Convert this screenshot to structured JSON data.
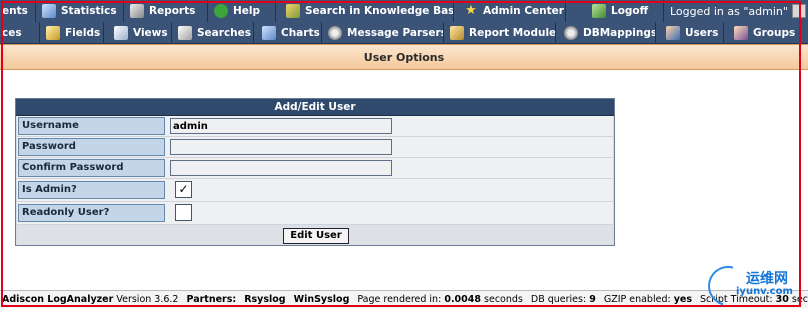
{
  "topnav": {
    "items": [
      {
        "label": "ents",
        "icon": "events-icon"
      },
      {
        "label": "Statistics",
        "icon": "statistics-icon"
      },
      {
        "label": "Reports",
        "icon": "reports-icon"
      },
      {
        "label": "Help",
        "icon": "help-icon"
      },
      {
        "label": "Search in Knowledge Base",
        "icon": "knowledge-base-icon"
      },
      {
        "label": "Admin Center",
        "icon": "star-icon"
      },
      {
        "label": "Logoff",
        "icon": "logoff-icon"
      }
    ],
    "login_text": "Logged in as \"admin\""
  },
  "subnav": {
    "items": [
      {
        "label": "ces",
        "icon": "sources-icon"
      },
      {
        "label": "Fields",
        "icon": "fields-icon"
      },
      {
        "label": "Views",
        "icon": "views-icon"
      },
      {
        "label": "Searches",
        "icon": "searches-icon"
      },
      {
        "label": "Charts",
        "icon": "charts-icon"
      },
      {
        "label": "Message Parsers",
        "icon": "gear-icon"
      },
      {
        "label": "Report Modules",
        "icon": "report-modules-icon"
      },
      {
        "label": "DBMappings",
        "icon": "gear-icon"
      },
      {
        "label": "Users",
        "icon": "users-icon"
      },
      {
        "label": "Groups",
        "icon": "groups-icon"
      }
    ]
  },
  "page": {
    "title": "User Options"
  },
  "form": {
    "heading": "Add/Edit User",
    "username_label": "Username",
    "username_value": "admin",
    "password_label": "Password",
    "password_value": "",
    "confirm_label": "Confirm Password",
    "confirm_value": "",
    "isadmin_label": "Is Admin?",
    "isadmin_checked": true,
    "isadmin_mark": "✓",
    "readonly_label": "Readonly User?",
    "readonly_checked": false,
    "submit_label": "Edit User"
  },
  "footer": {
    "product": "Adiscon LogAnalyzer",
    "version": "Version 3.6.2",
    "partners_label": "Partners:",
    "partner1": "Rsyslog",
    "partner2": "WinSyslog",
    "rendered_label": "Page rendered in:",
    "rendered_value": "0.0048",
    "rendered_unit": "seconds",
    "dbq_label": "DB queries:",
    "dbq_value": "9",
    "gzip_label": "GZIP enabled:",
    "gzip_value": "yes",
    "script_label": "Script Timeout:",
    "script_value": "30",
    "script_unit": "seconds"
  },
  "watermark": {
    "cn": "运维网",
    "url": "iyunv.com"
  },
  "colors": {
    "nav_bg": "#3b5376",
    "title_bg": "#f3c99a",
    "label_bg": "#c3d5e8",
    "frame": "#e0001a"
  }
}
